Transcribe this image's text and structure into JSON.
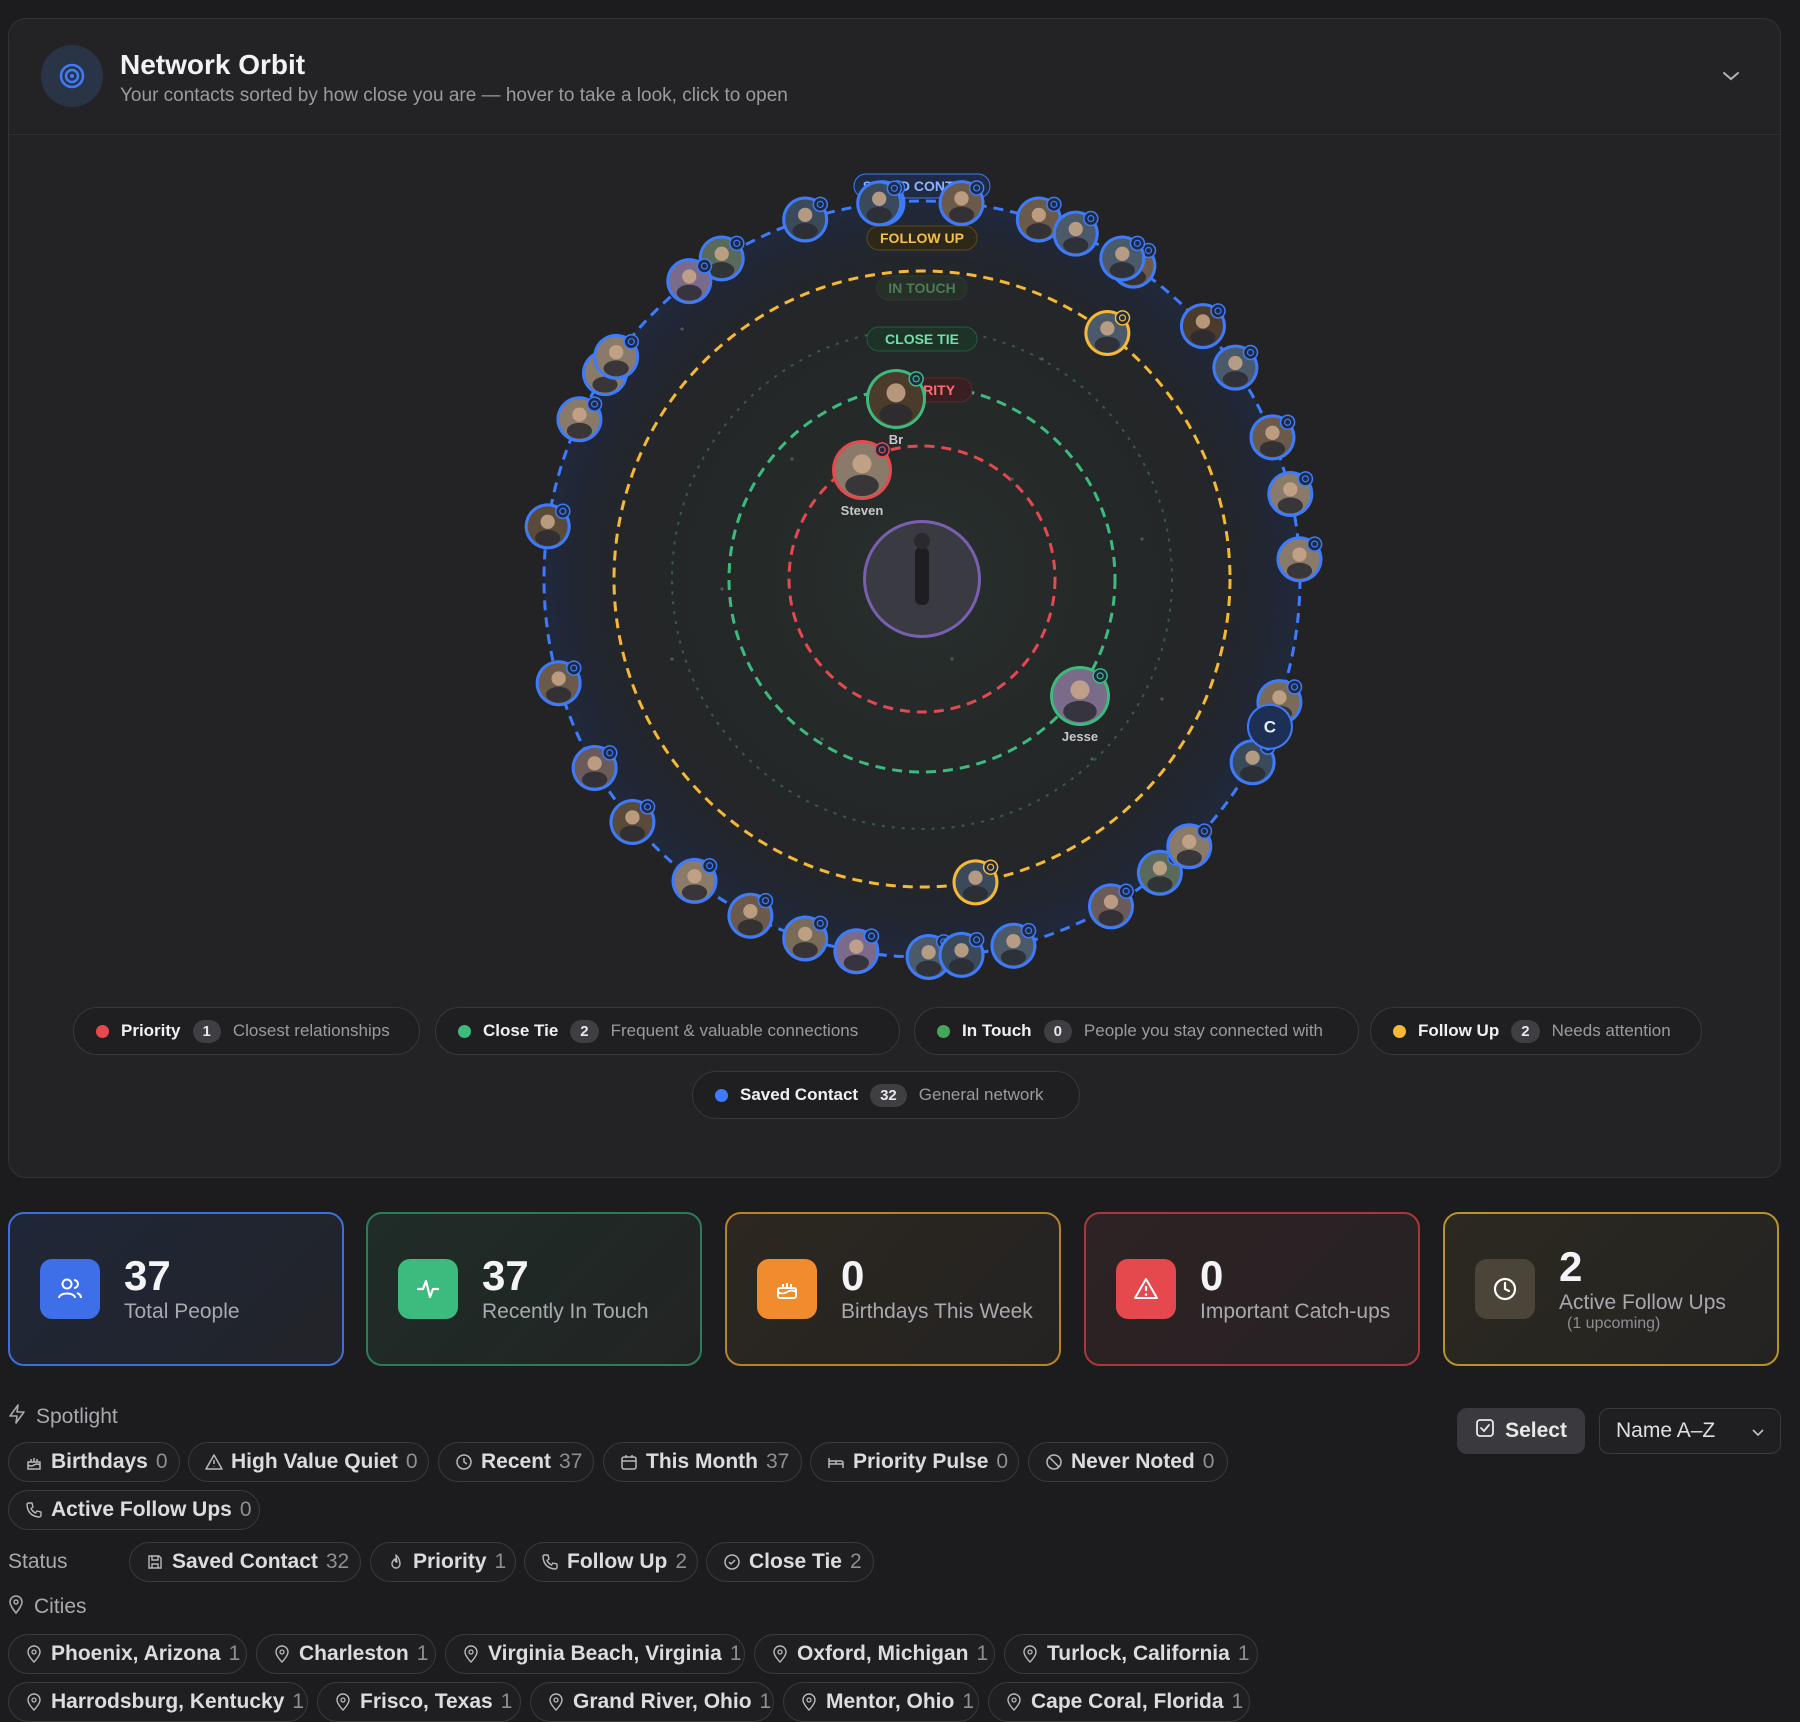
{
  "header": {
    "title": "Network Orbit",
    "subtitle": "Your contacts sorted by how close you are — hover to take a look, click to open"
  },
  "orbit": {
    "ring_labels": {
      "saved": "SAVED CONTACT",
      "follow": "FOLLOW UP",
      "intouch": "IN TOUCH",
      "close": "CLOSE TIE",
      "priority": "PRIORITY"
    },
    "named": {
      "steven": "Steven",
      "jesse": "Jesse",
      "b": "Br",
      "c": "C"
    }
  },
  "legend": [
    {
      "name": "Priority",
      "count": "1",
      "desc": "Closest relationships",
      "color": "#e5484d"
    },
    {
      "name": "Close Tie",
      "count": "2",
      "desc": "Frequent & valuable connections",
      "color": "#3dba7e"
    },
    {
      "name": "In Touch",
      "count": "0",
      "desc": "People you stay connected with",
      "color": "#46a758"
    },
    {
      "name": "Follow Up",
      "count": "2",
      "desc": "Needs attention",
      "color": "#f5b935"
    },
    {
      "name": "Saved Contact",
      "count": "32",
      "desc": "General network",
      "color": "#3e7bfa"
    }
  ],
  "stats": [
    {
      "value": "37",
      "label": "Total People",
      "sub": ""
    },
    {
      "value": "37",
      "label": "Recently In Touch",
      "sub": ""
    },
    {
      "value": "0",
      "label": "Birthdays This Week",
      "sub": ""
    },
    {
      "value": "0",
      "label": "Important Catch-ups",
      "sub": ""
    },
    {
      "value": "2",
      "label": "Active Follow Ups",
      "sub": "(1 upcoming)"
    }
  ],
  "spotlight": {
    "label": "Spotlight",
    "chips": [
      {
        "label": "Birthdays",
        "count": "0"
      },
      {
        "label": "High Value Quiet",
        "count": "0"
      },
      {
        "label": "Recent",
        "count": "37"
      },
      {
        "label": "This Month",
        "count": "37"
      },
      {
        "label": "Priority Pulse",
        "count": "0"
      },
      {
        "label": "Never Noted",
        "count": "0"
      },
      {
        "label": "Active Follow Ups",
        "count": "0"
      }
    ]
  },
  "toolbar": {
    "select_label": "Select",
    "sort_value": "Name A–Z"
  },
  "status": {
    "label": "Status",
    "chips": [
      {
        "label": "Saved Contact",
        "count": "32"
      },
      {
        "label": "Priority",
        "count": "1"
      },
      {
        "label": "Follow Up",
        "count": "2"
      },
      {
        "label": "Close Tie",
        "count": "2"
      }
    ]
  },
  "cities": {
    "label": "Cities",
    "chips": [
      {
        "label": "Phoenix, Arizona",
        "count": "1"
      },
      {
        "label": "Charleston",
        "count": "1"
      },
      {
        "label": "Virginia Beach, Virginia",
        "count": "1"
      },
      {
        "label": "Oxford, Michigan",
        "count": "1"
      },
      {
        "label": "Turlock, California",
        "count": "1"
      },
      {
        "label": "Harrodsburg, Kentucky",
        "count": "1"
      },
      {
        "label": "Frisco, Texas",
        "count": "1"
      },
      {
        "label": "Grand River, Ohio",
        "count": "1"
      },
      {
        "label": "Mentor, Ohio",
        "count": "1"
      },
      {
        "label": "Cape Coral, Florida",
        "count": "1"
      }
    ]
  }
}
